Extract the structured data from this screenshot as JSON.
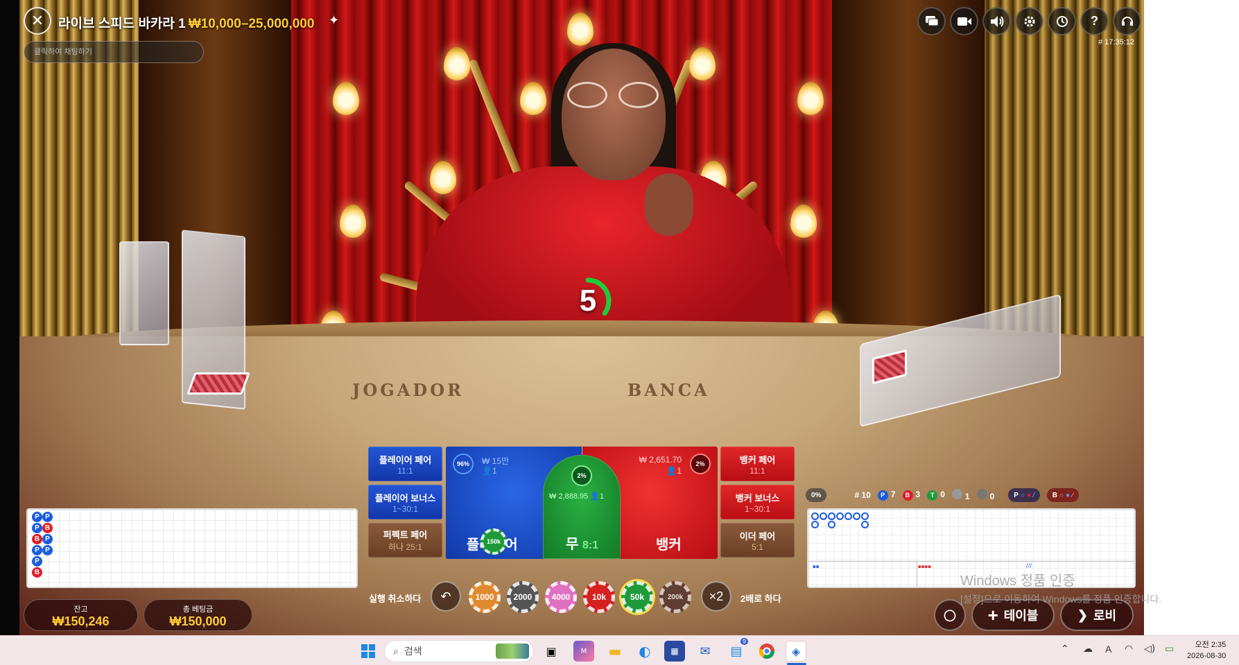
{
  "header": {
    "title": "라이브 스피드 바카라 1",
    "limits": "₩10,000–25,000,000",
    "chat_placeholder": "클릭하여 채팅하기",
    "round_id": "# 17:35:12",
    "icons": [
      "chat-icon",
      "video-icon",
      "sound-icon",
      "settings-icon",
      "history-icon",
      "help-icon",
      "support-icon"
    ]
  },
  "countdown": {
    "seconds": "5",
    "progress": 0.35
  },
  "felt": {
    "left_text": "JOGADOR",
    "right_text": "BANCA"
  },
  "side_bets": {
    "player_pair": {
      "label": "플레이어 페어",
      "odds": "11:1"
    },
    "player_bonus": {
      "label": "플레이어 보너스",
      "odds": "1~30:1"
    },
    "perfect_pair": {
      "label": "퍼펙트 페어",
      "odds": "하나 25:1"
    },
    "banker_pair": {
      "label": "뱅커 페어",
      "odds": "11:1"
    },
    "banker_bonus": {
      "label": "뱅커 보너스",
      "odds": "1~30:1"
    },
    "either_pair": {
      "label": "이더 페어",
      "odds": "5:1"
    }
  },
  "main_bets": {
    "player": {
      "label": "플레이어",
      "pct": "96%",
      "amount": "₩ 15만",
      "players": "1",
      "chip": "150k"
    },
    "tie": {
      "label": "무",
      "odds": "8:1",
      "pct": "2%",
      "amount": "₩ 2,888.95",
      "players": "1"
    },
    "banker": {
      "label": "뱅커",
      "pct": "2%",
      "amount": "₩ 2,651.70",
      "players": "1"
    }
  },
  "controls": {
    "undo_label": "실행 취소하다",
    "double_label": "2배로 하다",
    "double_button": "×2",
    "chips": [
      {
        "value": "1000",
        "color": "#e08a30"
      },
      {
        "value": "2000",
        "color": "#555555"
      },
      {
        "value": "4000",
        "color": "#e070c0"
      },
      {
        "value": "10k",
        "color": "#d62020"
      },
      {
        "value": "50k",
        "color": "#1f9a3a"
      },
      {
        "value": "200k",
        "color": "#4a2a2a"
      }
    ]
  },
  "balance": {
    "label": "잔고",
    "value": "₩150,246"
  },
  "total_bet": {
    "label": "총 베팅금",
    "value": "₩150,000"
  },
  "stats": {
    "rounds": "# 10",
    "player": "7",
    "banker": "3",
    "tie": "0",
    "player_pair": "1",
    "banker_pair": "0",
    "ask_player": "P",
    "ask_banker": "B",
    "pct": "0%"
  },
  "bead_road": [
    [
      "P",
      "P"
    ],
    [
      "P",
      "B"
    ],
    [
      "B",
      "P"
    ],
    [
      "P",
      "P"
    ],
    [
      "P"
    ],
    [
      "B"
    ]
  ],
  "bottom_buttons": {
    "table": "테이블",
    "lobby": "로비"
  },
  "watermark": {
    "line1": "Windows 정품 인증",
    "line2": "[설정]으로 이동하여 Windows를 정품 인증합니다."
  },
  "taskbar": {
    "search_placeholder": "검색",
    "time": "오전 2:35",
    "date": "2026-08-30",
    "badge": "9"
  }
}
